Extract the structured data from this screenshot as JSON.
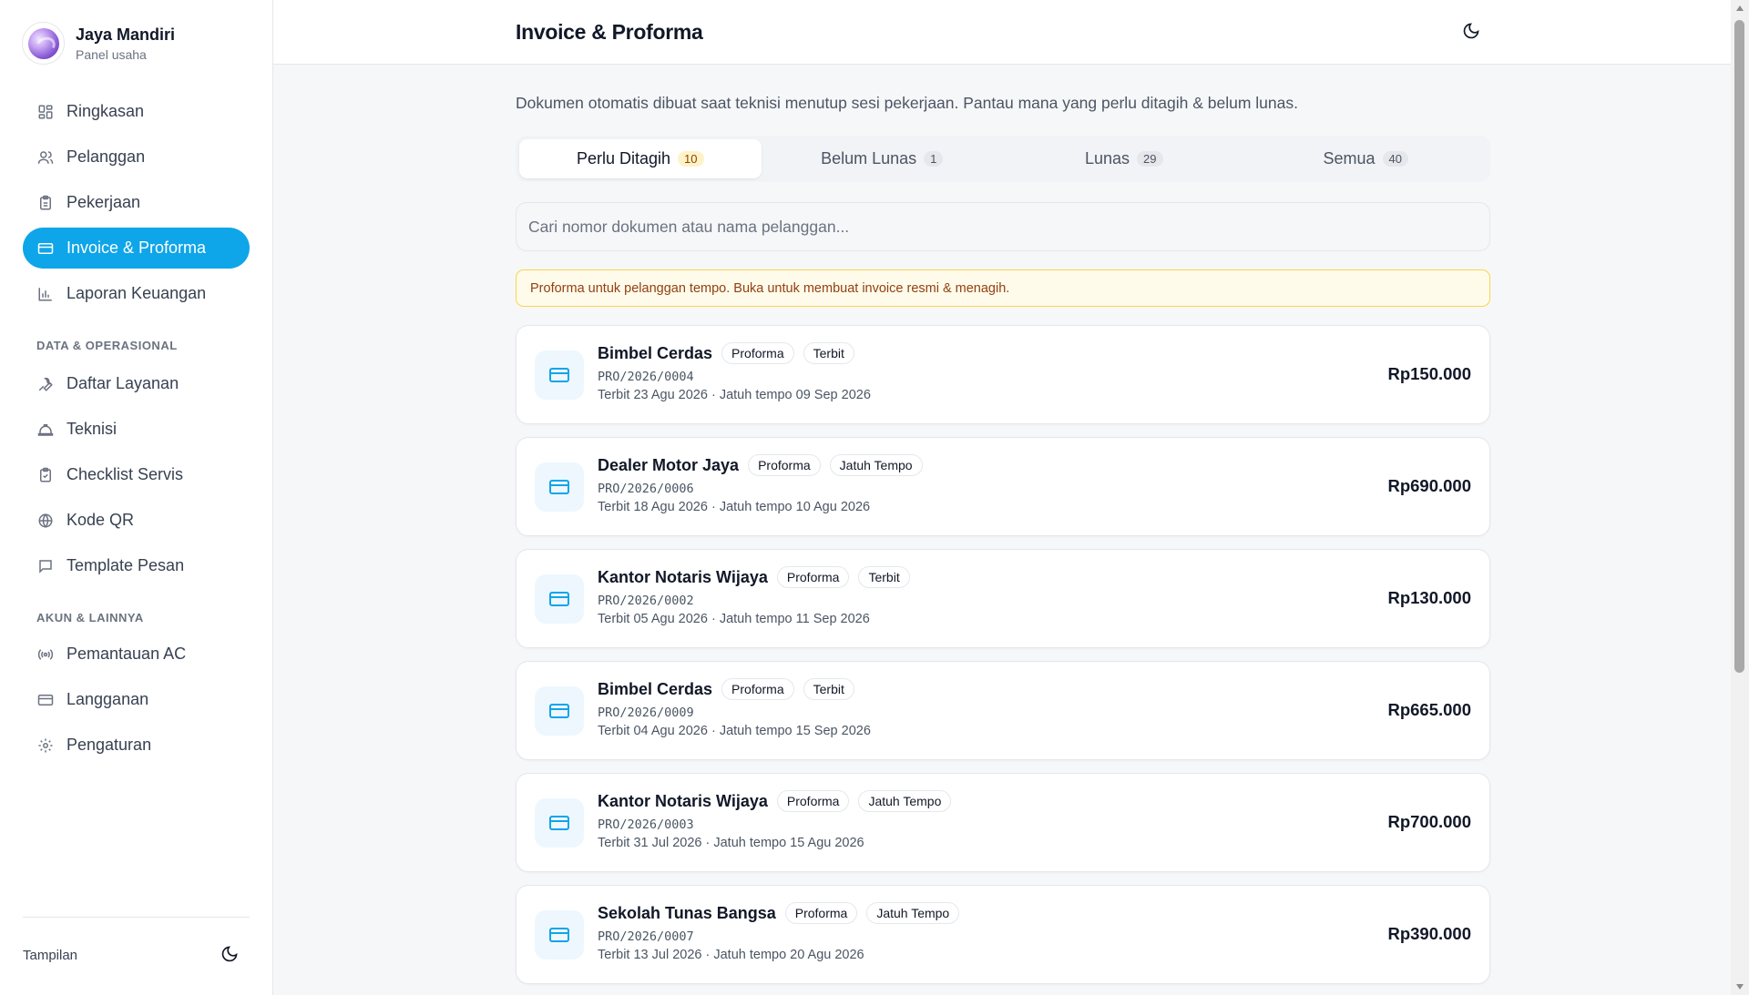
{
  "brand": {
    "name": "Jaya Mandiri",
    "subtitle": "Panel usaha"
  },
  "sidebar": {
    "main_items": [
      {
        "label": "Ringkasan",
        "icon": "dashboard-icon"
      },
      {
        "label": "Pelanggan",
        "icon": "users-icon"
      },
      {
        "label": "Pekerjaan",
        "icon": "clipboard-icon"
      },
      {
        "label": "Invoice & Proforma",
        "icon": "credit-card-icon",
        "active": true
      },
      {
        "label": "Laporan Keuangan",
        "icon": "bar-chart-icon"
      }
    ],
    "section_data": "DATA & OPERASIONAL",
    "data_items": [
      {
        "label": "Daftar Layanan",
        "icon": "wrench-icon"
      },
      {
        "label": "Teknisi",
        "icon": "hard-hat-icon"
      },
      {
        "label": "Checklist Servis",
        "icon": "clipboard-check-icon"
      },
      {
        "label": "Kode QR",
        "icon": "globe-icon"
      },
      {
        "label": "Template Pesan",
        "icon": "message-icon"
      }
    ],
    "section_account": "AKUN & LAINNYA",
    "account_items": [
      {
        "label": "Pemantauan AC",
        "icon": "radio-icon"
      },
      {
        "label": "Langganan",
        "icon": "credit-card-icon"
      },
      {
        "label": "Pengaturan",
        "icon": "gear-icon"
      }
    ],
    "footer_label": "Tampilan"
  },
  "header": {
    "title": "Invoice & Proforma"
  },
  "intro": "Dokumen otomatis dibuat saat teknisi menutup sesi pekerjaan. Pantau mana yang perlu ditagih & belum lunas.",
  "tabs": [
    {
      "label": "Perlu Ditagih",
      "count": "10",
      "active": true
    },
    {
      "label": "Belum Lunas",
      "count": "1"
    },
    {
      "label": "Lunas",
      "count": "29"
    },
    {
      "label": "Semua",
      "count": "40"
    }
  ],
  "search": {
    "placeholder": "Cari nomor dokumen atau nama pelanggan..."
  },
  "notice": "Proforma untuk pelanggan tempo. Buka untuk membuat invoice resmi & menagih.",
  "documents": [
    {
      "customer": "Bimbel Cerdas",
      "type": "Proforma",
      "status": "Terbit",
      "number": "PRO/2026/0004",
      "dates": "Terbit 23 Agu 2026 · Jatuh tempo 09 Sep 2026",
      "amount": "Rp150.000"
    },
    {
      "customer": "Dealer Motor Jaya",
      "type": "Proforma",
      "status": "Jatuh Tempo",
      "number": "PRO/2026/0006",
      "dates": "Terbit 18 Agu 2026 · Jatuh tempo 10 Agu 2026",
      "amount": "Rp690.000"
    },
    {
      "customer": "Kantor Notaris Wijaya",
      "type": "Proforma",
      "status": "Terbit",
      "number": "PRO/2026/0002",
      "dates": "Terbit 05 Agu 2026 · Jatuh tempo 11 Sep 2026",
      "amount": "Rp130.000"
    },
    {
      "customer": "Bimbel Cerdas",
      "type": "Proforma",
      "status": "Terbit",
      "number": "PRO/2026/0009",
      "dates": "Terbit 04 Agu 2026 · Jatuh tempo 15 Sep 2026",
      "amount": "Rp665.000"
    },
    {
      "customer": "Kantor Notaris Wijaya",
      "type": "Proforma",
      "status": "Jatuh Tempo",
      "number": "PRO/2026/0003",
      "dates": "Terbit 31 Jul 2026 · Jatuh tempo 15 Agu 2026",
      "amount": "Rp700.000"
    },
    {
      "customer": "Sekolah Tunas Bangsa",
      "type": "Proforma",
      "status": "Jatuh Tempo",
      "number": "PRO/2026/0007",
      "dates": "Terbit 13 Jul 2026 · Jatuh tempo 20 Agu 2026",
      "amount": "Rp390.000"
    }
  ],
  "colors": {
    "accent": "#0ea5e9",
    "notice_bg": "#fffbeb",
    "notice_border": "#fcd34d",
    "notice_text": "#92400e"
  }
}
